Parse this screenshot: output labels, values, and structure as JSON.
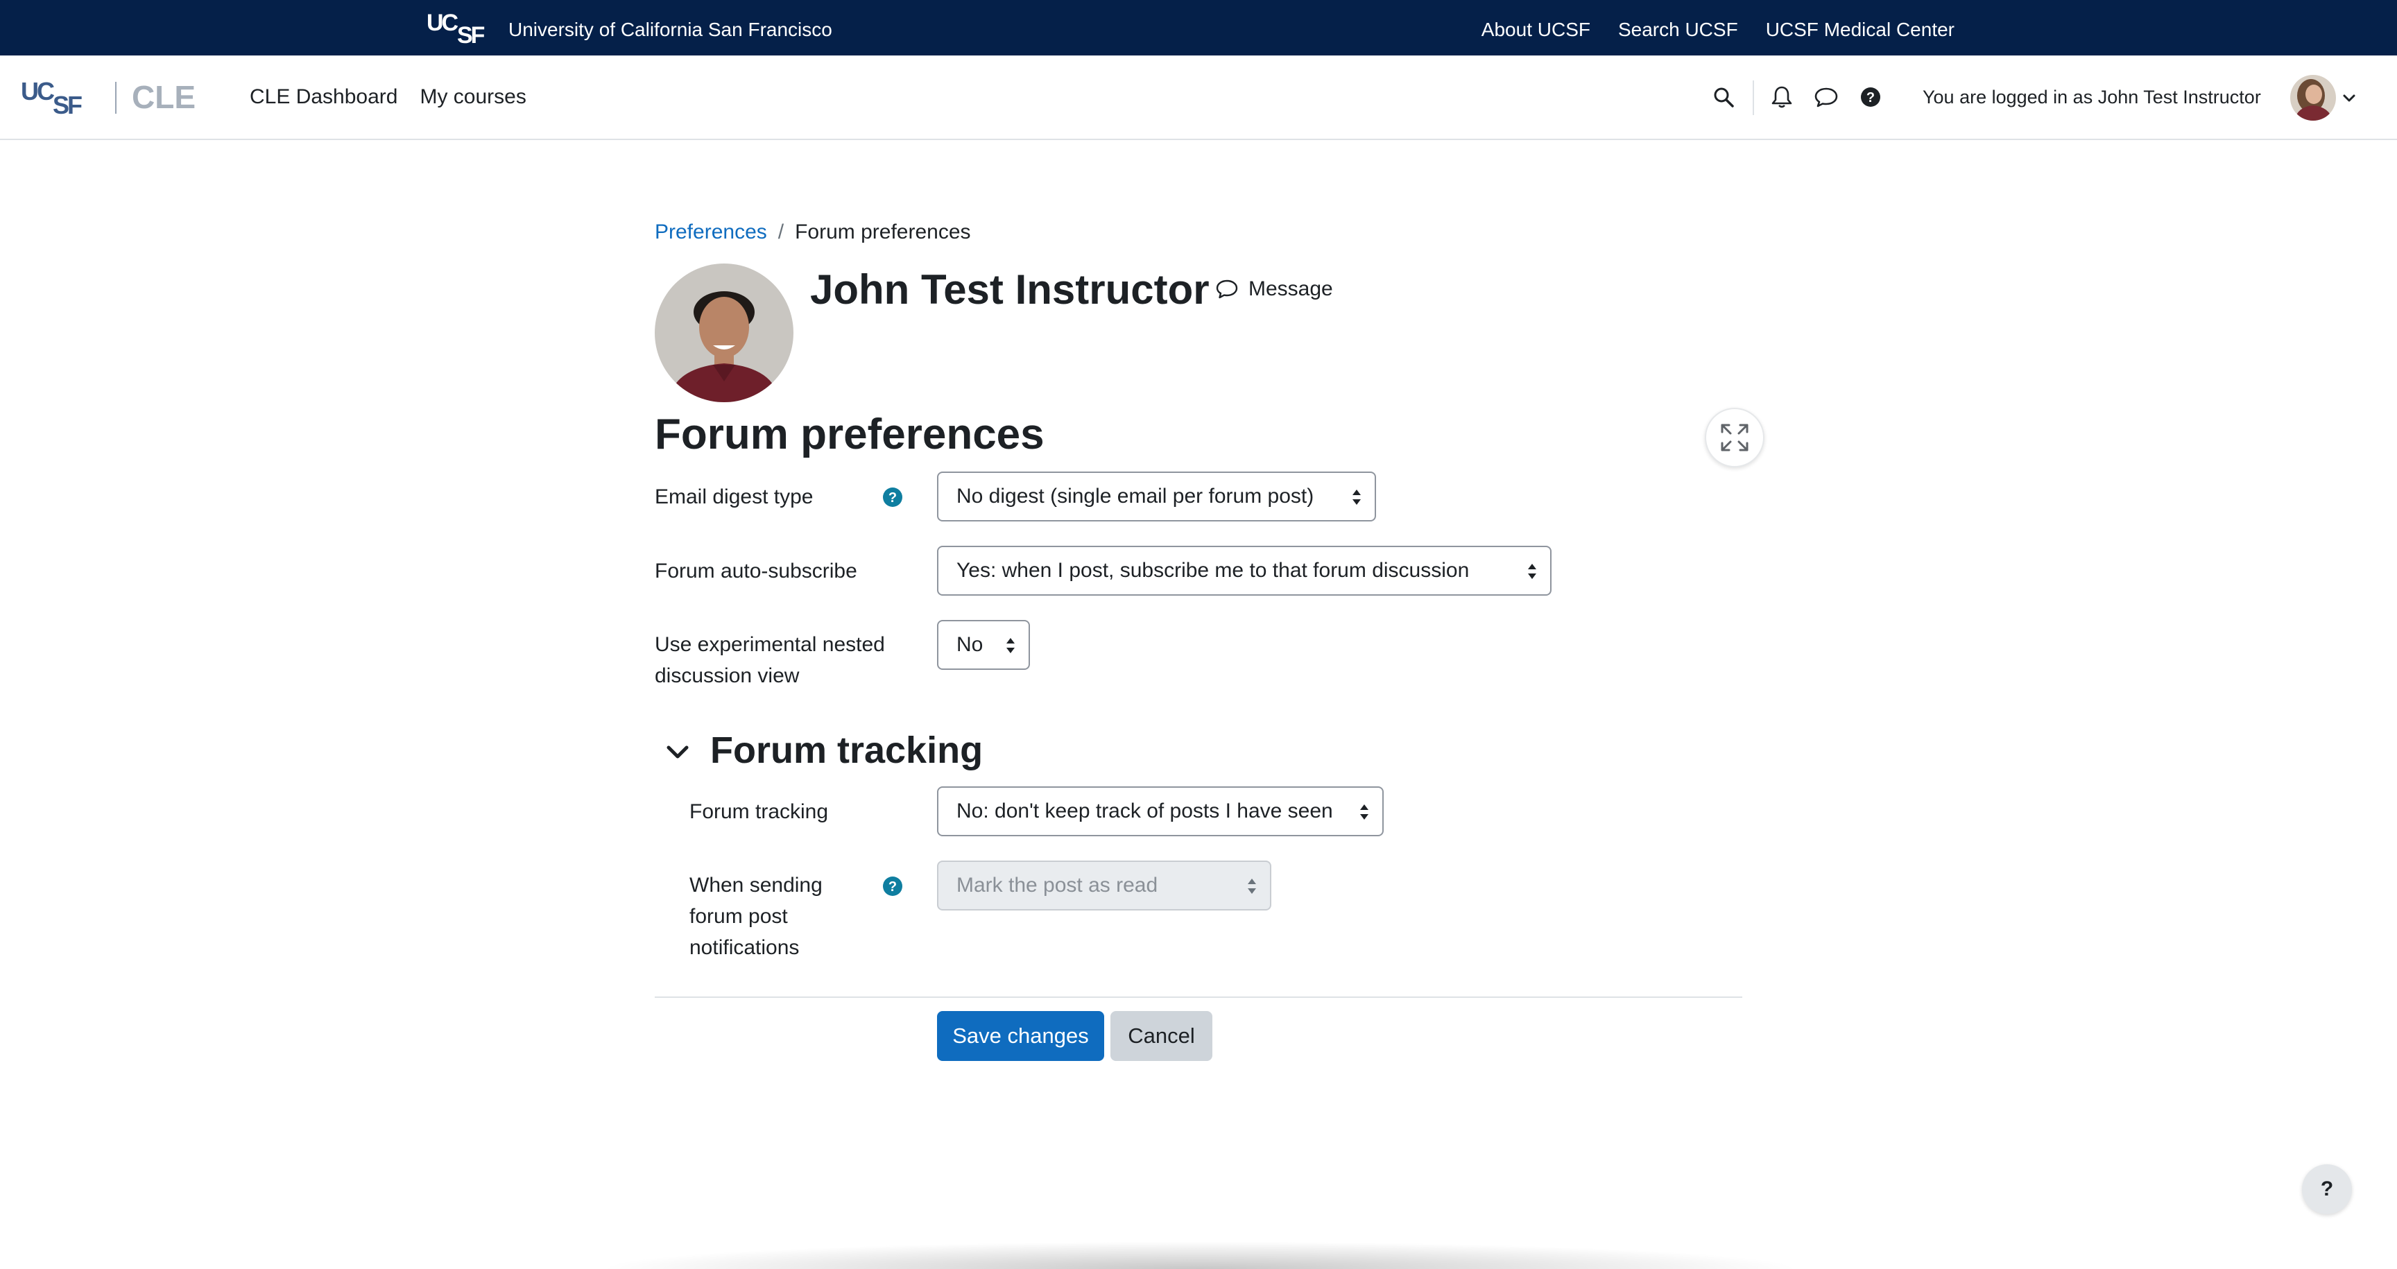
{
  "ucsf_bar": {
    "university_name": "University of California San Francisco",
    "links": [
      "About UCSF",
      "Search UCSF",
      "UCSF Medical Center"
    ]
  },
  "navbar": {
    "nav_links": [
      "CLE Dashboard",
      "My courses"
    ],
    "login_text": "You are logged in as John Test Instructor"
  },
  "breadcrumb": {
    "parent": "Preferences",
    "separator": "/",
    "current": "Forum preferences"
  },
  "profile": {
    "name": "John Test Instructor",
    "message_label": "Message"
  },
  "page": {
    "heading": "Forum preferences"
  },
  "form": {
    "email_digest": {
      "label": "Email digest type",
      "value": "No digest (single email per forum post)"
    },
    "auto_subscribe": {
      "label": "Forum auto-subscribe",
      "value": "Yes: when I post, subscribe me to that forum discussion"
    },
    "nested_view": {
      "label_line1": "Use experimental nested",
      "label_line2": "discussion view",
      "value": "No"
    },
    "tracking_section": {
      "heading": "Forum tracking",
      "tracking": {
        "label": "Forum tracking",
        "value": "No: don't keep track of posts I have seen"
      },
      "mark_read": {
        "label_line1": "When sending",
        "label_line2": "forum post",
        "label_line3": "notifications",
        "value": "Mark the post as read",
        "disabled": true
      }
    },
    "save_label": "Save changes",
    "cancel_label": "Cancel"
  },
  "help_fab_label": "?",
  "colors": {
    "ucsf_navy": "#052049",
    "primary": "#0f6cbf",
    "help_icon": "#0f7ea0",
    "secondary_button": "#ced4da"
  }
}
